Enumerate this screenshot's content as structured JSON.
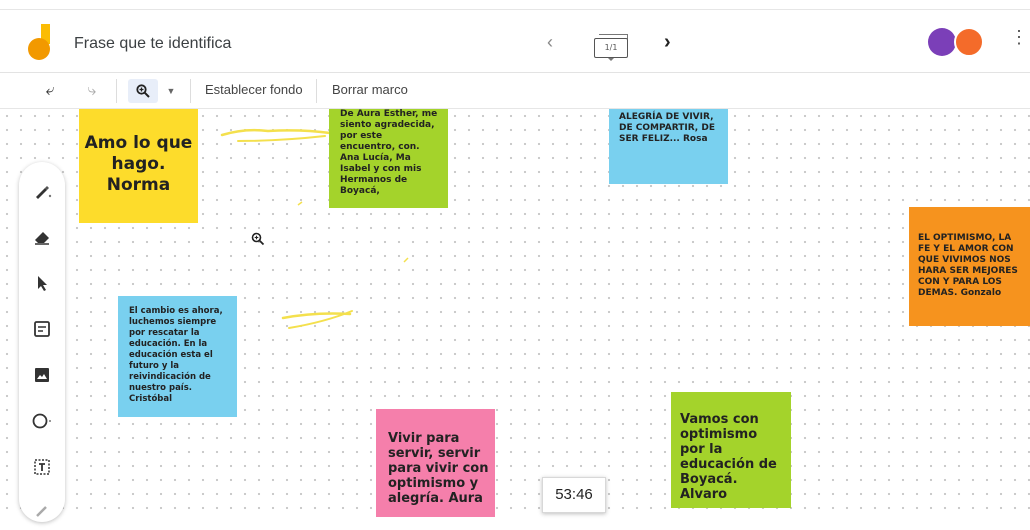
{
  "header": {
    "title": "Frase que te identifica",
    "frame_indicator": "1/1"
  },
  "toolbar": {
    "set_background": "Establecer fondo",
    "clear_frame": "Borrar marco"
  },
  "notes": {
    "yellow": "Amo lo que hago. Norma",
    "green1": "De Aura Esther, me siento agradecida, por este encuentro, con. Ana Lucía, Ma Isabel y con mis Hermanos de Boyacá,",
    "blue1": "ALEGRÍA DE VIVIR, DE COMPARTIR, DE SER FELIZ... Rosa",
    "orange": "EL OPTIMISMO, LA FE Y EL AMOR CON QUE VIVIMOS NOS HARA SER MEJORES CON Y PARA LOS DEMAS. Gonzalo",
    "blue2": "El cambio es ahora, luchemos siempre por rescatar la educación. En la educación esta el futuro y la reivindicación de nuestro país. Cristóbal",
    "pink": "Vivir para servir, servir para vivir con optimismo y alegría. Aura",
    "green2": "Vamos con optimismo por la educación de Boyacá. Alvaro"
  },
  "timer": "53:46",
  "colors": {
    "yellow": "#fddc2b",
    "green": "#a4d32b",
    "blue": "#79d0ef",
    "orange": "#f6931e",
    "pink": "#f57fab"
  }
}
